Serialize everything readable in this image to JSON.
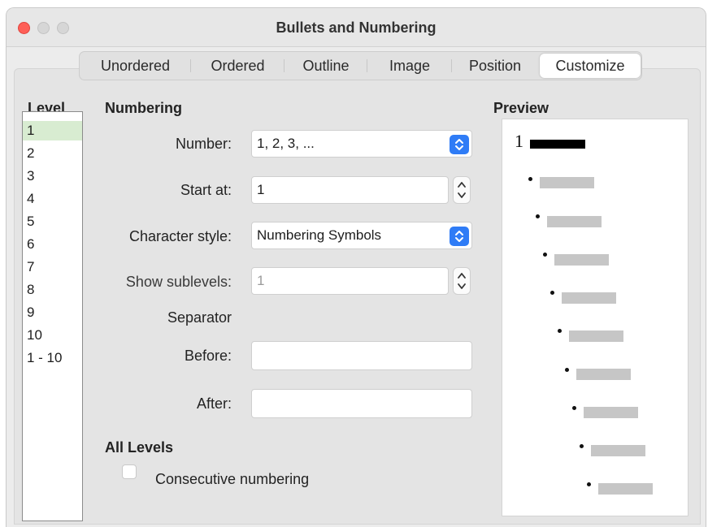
{
  "window": {
    "title": "Bullets and Numbering"
  },
  "tabs": [
    {
      "label": "Unordered"
    },
    {
      "label": "Ordered"
    },
    {
      "label": "Outline"
    },
    {
      "label": "Image"
    },
    {
      "label": "Position"
    },
    {
      "label": "Customize",
      "active": true
    }
  ],
  "level": {
    "heading": "Level",
    "items": [
      "1",
      "2",
      "3",
      "4",
      "5",
      "6",
      "7",
      "8",
      "9",
      "10",
      "1 - 10"
    ],
    "selected": "1"
  },
  "numbering": {
    "heading": "Numbering",
    "number_label": "Number:",
    "number_value": "1, 2, 3, ...",
    "start_label": "Start at:",
    "start_value": "1",
    "charstyle_label": "Character style:",
    "charstyle_value": "Numbering Symbols",
    "sublevels_label": "Show sublevels:",
    "sublevels_value": "1",
    "separator_label": "Separator",
    "before_label": "Before:",
    "before_value": "",
    "after_label": "After:",
    "after_value": ""
  },
  "all_levels": {
    "heading": "All Levels",
    "consecutive_label": "Consecutive numbering",
    "consecutive_checked": false
  },
  "preview": {
    "heading": "Preview",
    "first_number": "1"
  },
  "colors": {
    "close_button": "#fe5f57",
    "select_accent": "#2f7cf6",
    "selected_row": "#d8ecd1"
  }
}
